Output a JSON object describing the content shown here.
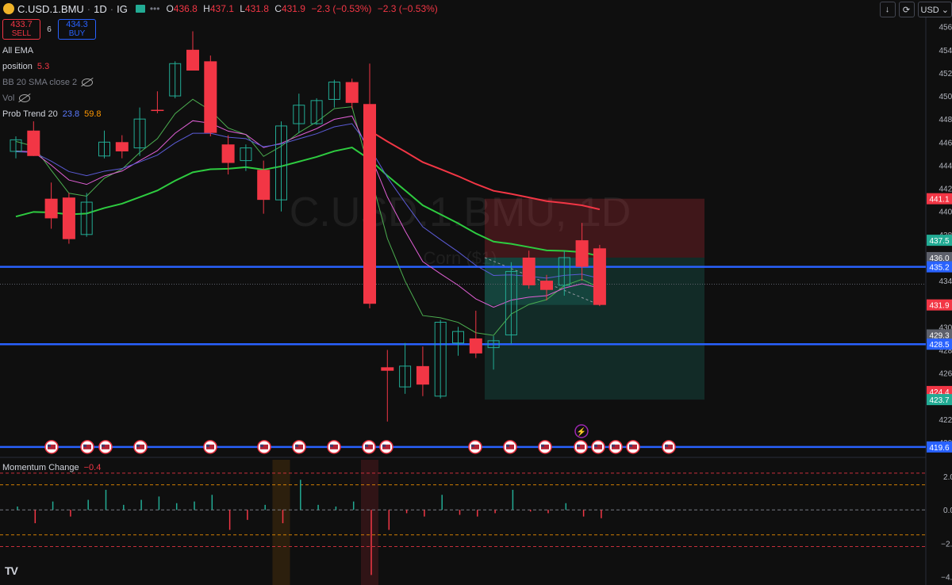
{
  "header": {
    "symbol": "C.USD.1.BMU",
    "interval": "1D",
    "broker": "IG",
    "more": "•••",
    "ohlc": [
      {
        "label": "O",
        "value": "436.8"
      },
      {
        "label": "H",
        "value": "437.1"
      },
      {
        "label": "L",
        "value": "431.8"
      },
      {
        "label": "C",
        "value": "431.9"
      }
    ],
    "change": "−2.3 (−0.53%)",
    "change2": "−2.3 (−0.53%)"
  },
  "trade": {
    "sell_price": "433.7",
    "sell_label": "SELL",
    "qty": "6",
    "buy_price": "434.3",
    "buy_label": "BUY"
  },
  "top_right": {
    "download": "↓",
    "sync": "⟳",
    "currency": "USD ⌄"
  },
  "legend": {
    "ema": "All EMA",
    "position_label": "position",
    "position_value": "5.3",
    "bb": "BB 20 SMA close 2",
    "vol": "Vol",
    "prob_label": "Prob Trend 20",
    "prob_v1": "23.8",
    "prob_v2": "59.8"
  },
  "watermark": {
    "title": "C.USD.1.BMU, 1D",
    "subtitle": "Corn ($1)"
  },
  "momentum": {
    "label": "Momentum Change",
    "value": "−0.4"
  },
  "logo": "TV",
  "colors": {
    "up": "#22ab94",
    "down": "#f23645",
    "bg": "#0f0f0f",
    "line_blue": "#2962ff"
  },
  "chart_data": {
    "type": "candlestick",
    "y_axis": {
      "ticks": [
        "456.0",
        "454.0",
        "452.0",
        "450.0",
        "448.0",
        "446.0",
        "444.0",
        "442.0",
        "440.0",
        "438.0",
        "436.0",
        "434.0",
        "432.0",
        "430.0",
        "428.0",
        "426.0",
        "424.0",
        "422.0",
        "420.0"
      ],
      "range": [
        420.0,
        456.8
      ]
    },
    "price_tags": [
      {
        "value": "441.1",
        "color": "#f23645"
      },
      {
        "value": "437.5",
        "color": "#22ab94"
      },
      {
        "value": "436.0",
        "color": "#5d606b"
      },
      {
        "value": "435.2",
        "color": "#2962ff"
      },
      {
        "value": "431.9",
        "color": "#f23645"
      },
      {
        "value": "429.3",
        "color": "#5d606b"
      },
      {
        "value": "428.5",
        "color": "#2962ff"
      },
      {
        "value": "424.4",
        "color": "#f23645"
      },
      {
        "value": "423.7",
        "color": "#22ab94"
      },
      {
        "value": "419.6",
        "color": "#2962ff"
      }
    ],
    "hlines": [
      435.2,
      428.5,
      419.6
    ],
    "position_box": {
      "entry": 436.0,
      "stop": 441.1,
      "target": 423.7,
      "current": 431.9
    },
    "candles": [
      {
        "o": 445.2,
        "h": 446.5,
        "l": 444.6,
        "c": 446.2
      },
      {
        "o": 447.0,
        "h": 447.8,
        "l": 444.8,
        "c": 444.8
      },
      {
        "o": 441.1,
        "h": 442.5,
        "l": 438.5,
        "c": 439.4
      },
      {
        "o": 441.2,
        "h": 441.6,
        "l": 437.2,
        "c": 437.6
      },
      {
        "o": 438.0,
        "h": 441.6,
        "l": 437.8,
        "c": 440.8
      },
      {
        "o": 444.8,
        "h": 447.0,
        "l": 444.6,
        "c": 446.0
      },
      {
        "o": 446.0,
        "h": 446.6,
        "l": 444.6,
        "c": 445.2
      },
      {
        "o": 445.5,
        "h": 449.0,
        "l": 444.8,
        "c": 448.0
      },
      {
        "o": 448.8,
        "h": 450.4,
        "l": 448.5,
        "c": 448.7
      },
      {
        "o": 450.0,
        "h": 453.0,
        "l": 449.8,
        "c": 452.8
      },
      {
        "o": 454.0,
        "h": 455.6,
        "l": 452.2,
        "c": 452.2
      },
      {
        "o": 453.0,
        "h": 453.5,
        "l": 446.5,
        "c": 446.8
      },
      {
        "o": 445.8,
        "h": 446.6,
        "l": 443.2,
        "c": 444.2
      },
      {
        "o": 444.4,
        "h": 445.8,
        "l": 443.5,
        "c": 445.5
      },
      {
        "o": 443.6,
        "h": 444.4,
        "l": 439.8,
        "c": 441.0
      },
      {
        "o": 441.0,
        "h": 447.8,
        "l": 440.0,
        "c": 447.4
      },
      {
        "o": 447.6,
        "h": 450.2,
        "l": 446.8,
        "c": 449.2
      },
      {
        "o": 447.6,
        "h": 449.8,
        "l": 447.5,
        "c": 449.6
      },
      {
        "o": 449.7,
        "h": 451.4,
        "l": 449.0,
        "c": 451.2
      },
      {
        "o": 451.2,
        "h": 451.5,
        "l": 448.9,
        "c": 449.4
      },
      {
        "o": 449.3,
        "h": 452.8,
        "l": 431.6,
        "c": 432.0
      },
      {
        "o": 426.5,
        "h": 428.0,
        "l": 421.8,
        "c": 426.2
      },
      {
        "o": 424.8,
        "h": 428.6,
        "l": 424.2,
        "c": 426.6
      },
      {
        "o": 426.6,
        "h": 428.3,
        "l": 424.0,
        "c": 425.0
      },
      {
        "o": 424.0,
        "h": 430.6,
        "l": 423.8,
        "c": 430.4
      },
      {
        "o": 428.6,
        "h": 430.0,
        "l": 427.5,
        "c": 429.6
      },
      {
        "o": 429.0,
        "h": 431.4,
        "l": 427.3,
        "c": 427.7
      },
      {
        "o": 428.2,
        "h": 429.2,
        "l": 426.3,
        "c": 428.8
      },
      {
        "o": 429.3,
        "h": 435.6,
        "l": 428.5,
        "c": 434.8
      },
      {
        "o": 436.0,
        "h": 436.6,
        "l": 433.3,
        "c": 433.6
      },
      {
        "o": 434.0,
        "h": 434.5,
        "l": 432.3,
        "c": 433.2
      },
      {
        "o": 433.6,
        "h": 436.6,
        "l": 432.7,
        "c": 436.0
      },
      {
        "o": 437.5,
        "h": 439.0,
        "l": 434.0,
        "c": 435.2
      },
      {
        "o": 436.8,
        "h": 437.1,
        "l": 431.8,
        "c": 431.9
      }
    ],
    "momentum": {
      "ticks": [
        "2.0",
        "0.0",
        "−2.0",
        "−4.0"
      ],
      "range": [
        -4.5,
        3.0
      ],
      "dashed_levels": [
        2.2,
        1.5,
        -1.5,
        -2.2
      ],
      "values": [
        0.2,
        -0.8,
        0.5,
        -0.4,
        0.6,
        1.2,
        0.3,
        0.6,
        0.8,
        0.4,
        0.5,
        0.9,
        -1.2,
        -0.6,
        0.3,
        -0.8,
        1.8,
        0.3,
        0.2,
        0.5,
        -3.9,
        -1.2,
        -0.2,
        -0.4,
        0.9,
        -0.3,
        -0.4,
        -0.2,
        1.2,
        -0.1,
        -0.2,
        0.4,
        -0.4,
        -0.5
      ]
    },
    "flag_count": 18,
    "lightning_events": 1
  }
}
